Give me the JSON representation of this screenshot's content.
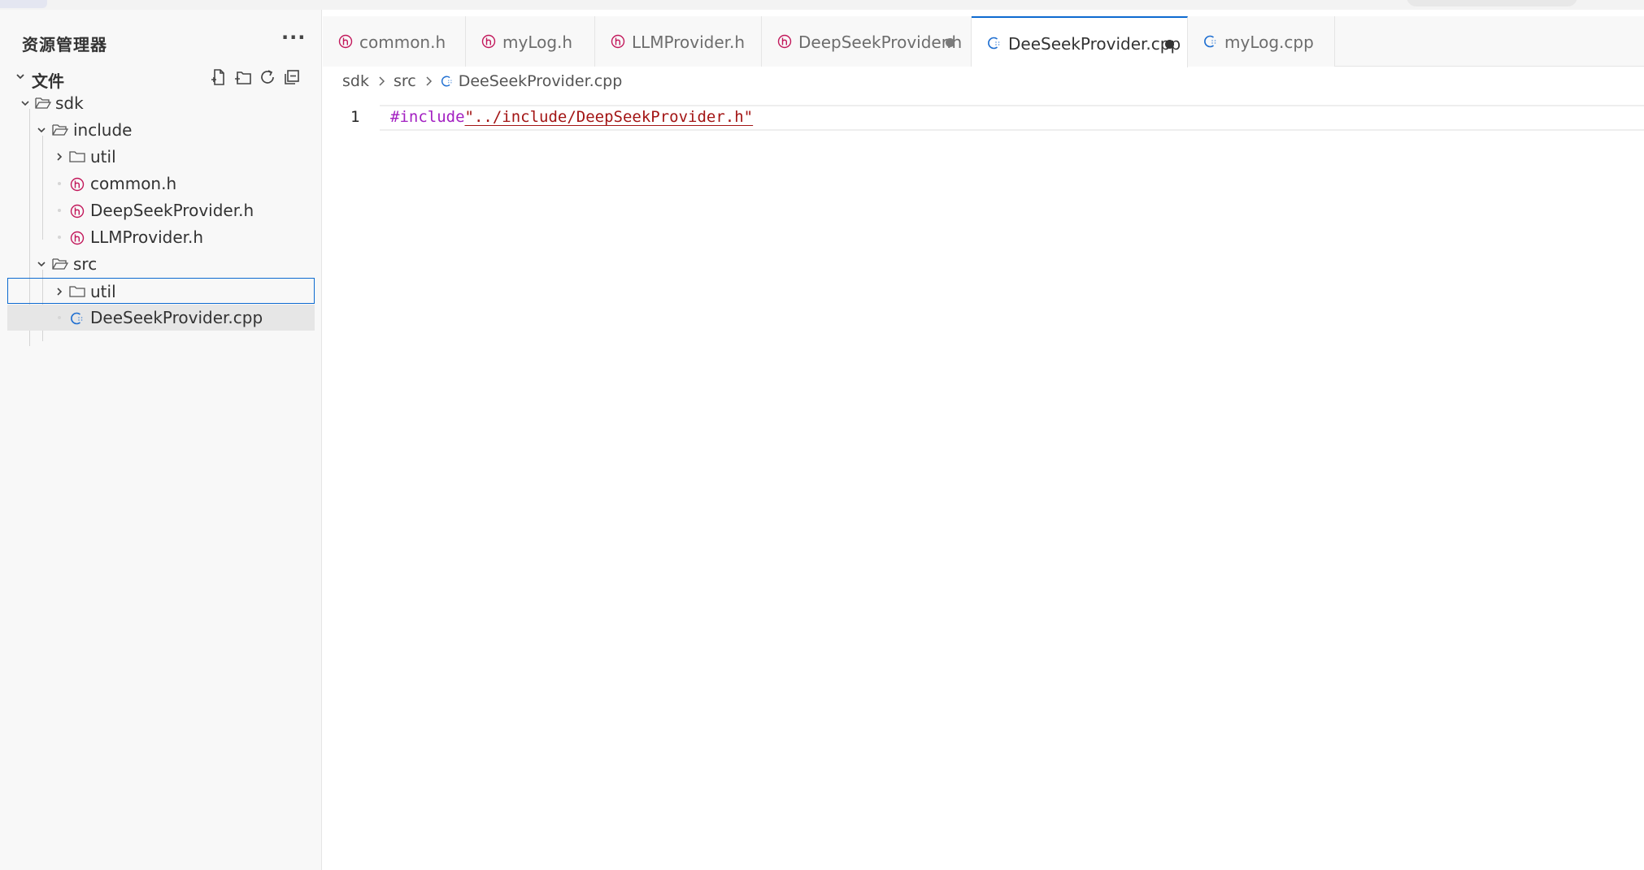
{
  "sidebar": {
    "title": "资源管理器",
    "more_glyph": "···",
    "section_label": "文件",
    "actions": [
      "new-file-icon",
      "new-folder-icon",
      "refresh-icon",
      "collapse-all-icon"
    ],
    "tree": [
      {
        "label": "sdk",
        "kind": "folder",
        "expanded": true
      },
      {
        "label": "include",
        "kind": "folder",
        "expanded": true
      },
      {
        "label": "util",
        "kind": "folder",
        "expanded": false
      },
      {
        "label": "common.h",
        "kind": "header"
      },
      {
        "label": "DeepSeekProvider.h",
        "kind": "header"
      },
      {
        "label": "LLMProvider.h",
        "kind": "header"
      },
      {
        "label": "src",
        "kind": "folder",
        "expanded": true
      },
      {
        "label": "util",
        "kind": "folder",
        "expanded": false,
        "focused": true
      },
      {
        "label": "DeeSeekProvider.cpp",
        "kind": "cpp",
        "selected": true
      }
    ]
  },
  "tabs": [
    {
      "label": "common.h",
      "kind": "header",
      "modified": false,
      "active": false
    },
    {
      "label": "myLog.h",
      "kind": "header",
      "modified": false,
      "active": false
    },
    {
      "label": "LLMProvider.h",
      "kind": "header",
      "modified": false,
      "active": false
    },
    {
      "label": "DeepSeekProvider.h",
      "kind": "header",
      "modified": true,
      "active": false
    },
    {
      "label": "DeeSeekProvider.cpp",
      "kind": "cpp",
      "modified": true,
      "active": true
    },
    {
      "label": "myLog.cpp",
      "kind": "cpp",
      "modified": false,
      "active": false
    }
  ],
  "breadcrumb": {
    "parts": [
      "sdk",
      "src",
      "DeeSeekProvider.cpp"
    ]
  },
  "editor": {
    "line_number": "1",
    "directive": "#include",
    "include_path": "\"../include/DeepSeekProvider.h\""
  },
  "colors": {
    "accent": "#0d6ad0",
    "header_icon": "#c2185b",
    "cpp_icon": "#1f6fd1",
    "directive": "#a320c2",
    "string": "#a31515"
  }
}
